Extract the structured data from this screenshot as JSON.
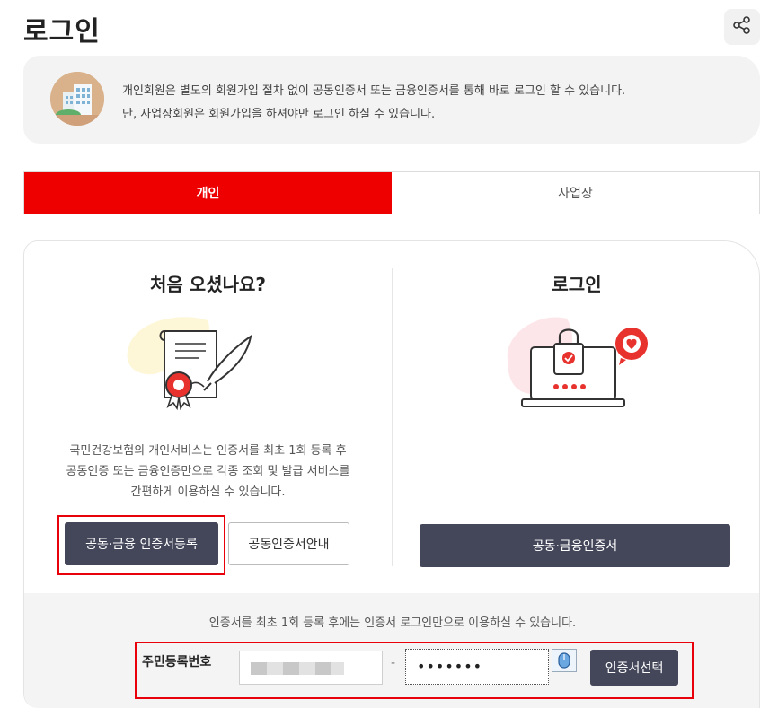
{
  "header": {
    "title": "로그인",
    "share_icon": "share-icon"
  },
  "notice": {
    "line1": "개인회원은 별도의 회원가입 절차 없이 공동인증서 또는 금융인증서를 통해 바로 로그인 할 수 있습니다.",
    "line2": "단, 사업장회원은 회원가입을 하셔야만 로그인 하실 수 있습니다.",
    "avatar_icon": "building-icon"
  },
  "tabs": [
    {
      "label": "개인",
      "active": true
    },
    {
      "label": "사업장",
      "active": false
    }
  ],
  "left": {
    "title": "처음 오셨나요?",
    "illustration": "certificate-icon",
    "desc_line1": "국민건강보험의 개인서비스는 인증서를 최초 1회 등록 후",
    "desc_line2": "공동인증 또는 금융인증만으로 각종 조회 및 발급 서비스를",
    "desc_line3": "간편하게 이용하실 수 있습니다.",
    "register_button": "공동·금융 인증서등록",
    "guide_button": "공동인증서안내"
  },
  "right": {
    "title": "로그인",
    "illustration": "laptop-lock-icon",
    "login_button": "공동·금융인증서"
  },
  "bottom": {
    "note": "인증서를 최초 1회 등록 후에는 인증서 로그인만으로 이용하실 수 있습니다.",
    "field_label": "주민등록번호",
    "dash": "-",
    "rrn_second_value": "•••••••",
    "select_button": "인증서선택",
    "keyboard_icon": "mouse-keypad-icon"
  },
  "colors": {
    "accent": "#ee0000",
    "dark_button": "#44475a",
    "highlight_box": "#e8000b"
  }
}
